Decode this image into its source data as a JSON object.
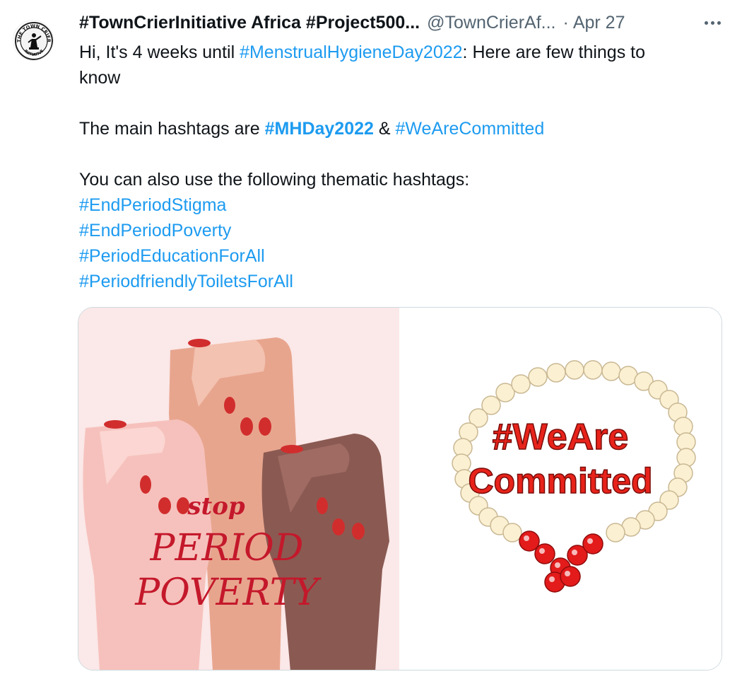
{
  "tweet": {
    "display_name": "#TownCrierInitiative Africa #Project500...",
    "handle": "@TownCrierAf...",
    "separator": "·",
    "date": "Apr 27",
    "text": {
      "line1_prefix": "Hi, It's 4 weeks until ",
      "line1_tag": "#MenstrualHygieneDay2022",
      "line1_suffix": ": Here are few things to",
      "line2": "know",
      "line3_prefix": "The main hashtags are ",
      "line3_tag1": "#MHDay2022",
      "line3_mid": " & ",
      "line3_tag2": "#WeAreCommitted",
      "line4": "You can also use the following thematic hashtags:",
      "hashtags": [
        "#EndPeriodStigma",
        "#EndPeriodPoverty",
        "#PeriodEducationForAll",
        "#PeriodfriendlyToiletsForAll"
      ]
    },
    "avatar": {
      "icon": "town-crier-logo-icon",
      "text_top": "THE TOWN CRIER",
      "text_bottom": "INITIATIVE"
    },
    "media": {
      "left": {
        "line1": "stop",
        "line2": "PERIOD",
        "line3": "POVERTY"
      },
      "right": {
        "line1": "#WeAre",
        "line2": "Committed"
      }
    }
  },
  "colors": {
    "link": "#1d9bf0",
    "muted": "#536471",
    "text": "#0f1419",
    "poster_red": "#e8231b",
    "script_red": "#c4182b"
  }
}
